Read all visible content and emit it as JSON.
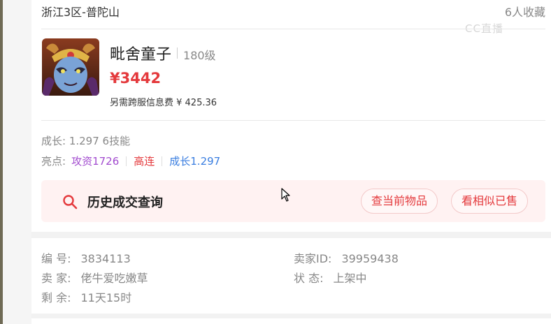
{
  "header": {
    "server": "浙江3区-普陀山",
    "favorites": "6人收藏",
    "watermark": "CC直播"
  },
  "item": {
    "name": "毗舍童子",
    "level": "180级",
    "price": "¥3442",
    "fee": "另需跨服信息费 ¥ 425.36",
    "growth": "成长: 1.297 6技能",
    "highlights_label": "亮点:",
    "highlights": [
      "攻资1726",
      "高连",
      "成长1.297"
    ]
  },
  "history": {
    "title": "历史成交查询",
    "btn_current": "查当前物品",
    "btn_similar": "看相似已售"
  },
  "info": {
    "id_label": "编 号:",
    "id_value": "3834113",
    "seller_id_label": "卖家ID:",
    "seller_id_value": "39959438",
    "seller_label": "卖 家:",
    "seller_value": "佬牛爱吃嫩草",
    "status_label": "状 态:",
    "status_value": "上架中",
    "remaining_label": "剩 余:",
    "remaining_value": "11天15时"
  },
  "colors": {
    "price_red": "#e4393c",
    "highlight_purple": "#a24bcf",
    "highlight_red": "#e4393c",
    "highlight_blue": "#3a7ee0",
    "history_bg": "#fff2f2"
  },
  "icons": [
    "search-icon",
    "cursor-icon",
    "avatar-image"
  ]
}
